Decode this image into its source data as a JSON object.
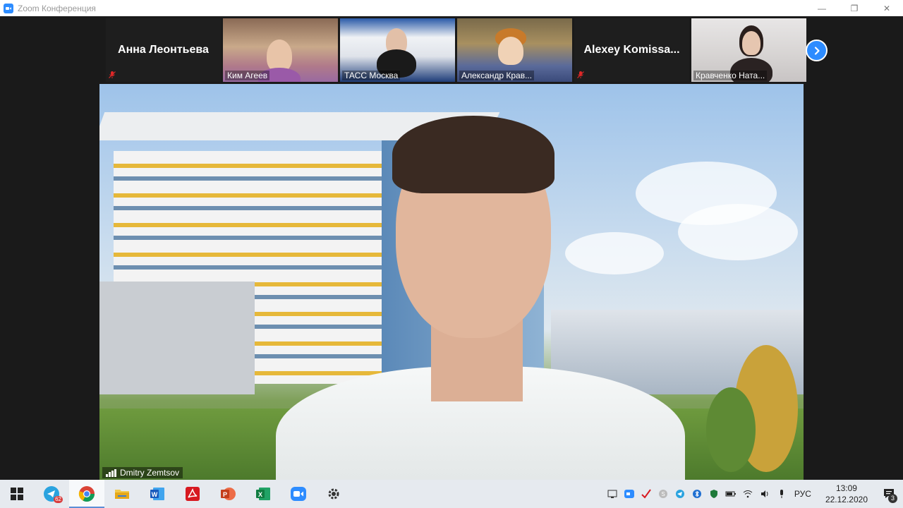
{
  "window": {
    "title": "Zoom Конференция",
    "controls": {
      "minimize": "—",
      "restore": "❐",
      "close": "✕"
    }
  },
  "participants": [
    {
      "name": "Анна Леонтьева",
      "video": false,
      "muted": true
    },
    {
      "name": "Ким Агеев",
      "video": true,
      "muted": false
    },
    {
      "name": "ТАСС Москва",
      "video": true,
      "muted": false
    },
    {
      "name": "Александр Крав...",
      "video": true,
      "muted": false
    },
    {
      "name": "Alexey  Komissa...",
      "video": false,
      "muted": true
    },
    {
      "name": "Кравченко Ната...",
      "video": true,
      "muted": false
    }
  ],
  "active_speaker": {
    "name": "Dmitry Zemtsov"
  },
  "colors": {
    "zoom_blue": "#2d8cff",
    "mute_red": "#e02828",
    "taskbar_bg": "#e6eaef"
  },
  "taskbar": {
    "apps": [
      {
        "icon": "telegram-icon",
        "badge": "62",
        "active": false
      },
      {
        "icon": "chrome-icon",
        "active": true
      },
      {
        "icon": "file-explorer-icon",
        "active": false
      },
      {
        "icon": "word-icon",
        "active": false
      },
      {
        "icon": "acrobat-icon",
        "active": false
      },
      {
        "icon": "powerpoint-icon",
        "active": false
      },
      {
        "icon": "excel-icon",
        "active": false
      },
      {
        "icon": "zoom-icon",
        "active": false
      },
      {
        "icon": "settings-icon",
        "active": false
      }
    ],
    "language": "РУС",
    "time": "13:09",
    "date": "22.12.2020",
    "notifications": "3"
  }
}
